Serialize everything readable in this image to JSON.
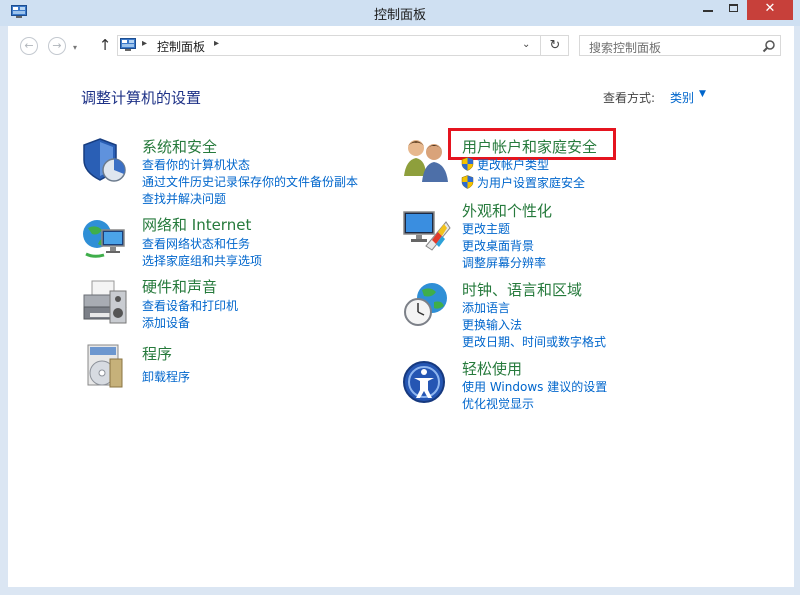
{
  "window": {
    "title": "控制面板",
    "close_glyph": "✕"
  },
  "nav": {
    "back_icon": "back-arrow-icon",
    "forward_icon": "forward-arrow-icon",
    "up_glyph": "↑",
    "address": {
      "breadcrumb": "控制面板",
      "sep": "▸",
      "dropdown": "⌄",
      "refresh": "↻"
    },
    "search": {
      "placeholder": "搜索控制面板"
    }
  },
  "header": {
    "title": "调整计算机的设置",
    "view_by_label": "查看方式:",
    "view_by_value": "类别",
    "view_by_arrow": "▼"
  },
  "categories": [
    {
      "title": "系统和安全",
      "icon": "shield-icon",
      "links": [
        "查看你的计算机状态",
        "通过文件历史记录保存你的文件备份副本",
        "查找并解决问题"
      ]
    },
    {
      "title": "网络和 Internet",
      "icon": "network-icon",
      "links": [
        "查看网络状态和任务",
        "选择家庭组和共享选项"
      ]
    },
    {
      "title": "硬件和声音",
      "icon": "printer-icon",
      "links": [
        "查看设备和打印机",
        "添加设备"
      ]
    },
    {
      "title": "程序",
      "icon": "programs-icon",
      "links": [
        "卸载程序"
      ]
    },
    {
      "title": "用户帐户和家庭安全",
      "icon": "users-icon",
      "links": [
        "更改帐户类型",
        "为用户设置家庭安全"
      ]
    },
    {
      "title": "外观和个性化",
      "icon": "display-icon",
      "links": [
        "更改主题",
        "更改桌面背景",
        "调整屏幕分辨率"
      ]
    },
    {
      "title": "时钟、语言和区域",
      "icon": "clock-globe-icon",
      "links": [
        "添加语言",
        "更换输入法",
        "更改日期、时间或数字格式"
      ]
    },
    {
      "title": "轻松使用",
      "icon": "ease-of-access-icon",
      "links": [
        "使用 Windows 建议的设置",
        "优化视觉显示"
      ]
    }
  ],
  "colors": {
    "title_link": "#267a3c",
    "link": "#0066cc",
    "heading": "#1e3287",
    "highlight": "#e5141f"
  }
}
